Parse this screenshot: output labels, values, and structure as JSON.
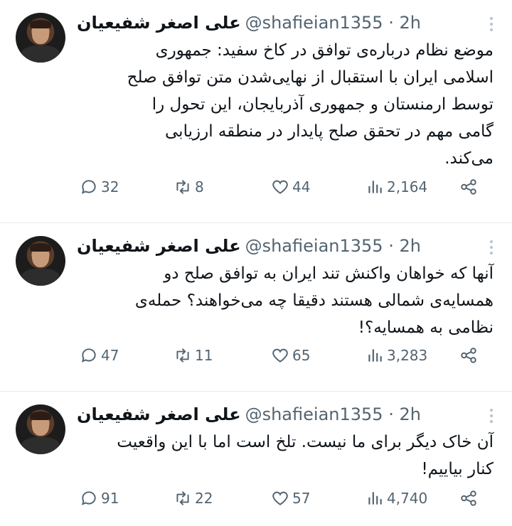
{
  "tweets": [
    {
      "author": "علی اصغر شفیعیان",
      "handle": "@shafieian1355",
      "time": "· 2h",
      "text": "موضع نظام درباره‌ی توافق در کاخ سفید: جمهوری\nاسلامی ایران با استقبال از نهایی‌شدن متن توافق صلح\nتوسط ارمنستان و جمهوری آذربایجان، این تحول را\nگامی مهم در تحقق صلح پایدار در منطقه ارزیابی\nمی‌کند.",
      "replies": "32",
      "retweets": "8",
      "likes": "44",
      "views": "2,164"
    },
    {
      "author": "علی اصغر شفیعیان",
      "handle": "@shafieian1355",
      "time": "· 2h",
      "text": "آنها که خواهان واکنش تند ایران به توافق صلح دو\nهمسایه‌ی شمالی هستند دقیقا چه می‌خواهند؟ حمله‌ی\nنظامی به همسایه؟!",
      "replies": "47",
      "retweets": "11",
      "likes": "65",
      "views": "3,283"
    },
    {
      "author": "علی اصغر شفیعیان",
      "handle": "@shafieian1355",
      "time": "· 2h",
      "text": "آن خاک دیگر برای ما نیست. تلخ است اما با این واقعیت\nکنار بیاییم!",
      "replies": "91",
      "retweets": "22",
      "likes": "57",
      "views": "4,740"
    }
  ],
  "icons": {
    "reply": "speech-bubble-icon",
    "retweet": "retweet-arrows-icon",
    "like": "heart-icon",
    "views": "bar-chart-icon",
    "share": "share-icon",
    "more": "vertical-dots-icon"
  },
  "colors": {
    "icon_gray": "#536471",
    "divider": "#e6e9ec"
  }
}
